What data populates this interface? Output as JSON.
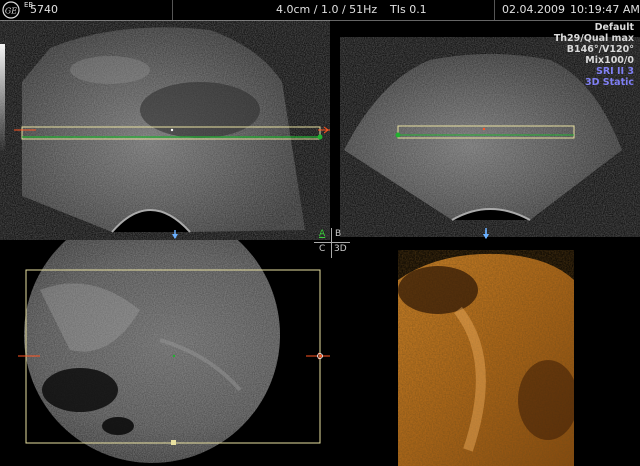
{
  "header": {
    "logo_text": "GE",
    "user": "EB",
    "probe_id": "5740",
    "depth_info": "4.0cm / 1.0 / 51Hz",
    "tis": "TIs  0.1",
    "date": "02.04.2009",
    "time": "10:19:47 AM"
  },
  "settings": {
    "lines": [
      "Default",
      "Th29/Qual max",
      "B146°/V120°",
      "Mix100/0"
    ],
    "mode_lines": [
      "SRI II 3",
      "3D Static"
    ],
    "mode_color": "#6a6aff"
  },
  "quad_selector": {
    "a": "A",
    "b": "B",
    "c": "C",
    "d": "3D",
    "active_color": "#3ad03a"
  },
  "colors": {
    "roi_box": "#e8e0a0",
    "plane_line": "#22b030",
    "marker": "#ff5522",
    "render_tint": "#c8781c"
  }
}
